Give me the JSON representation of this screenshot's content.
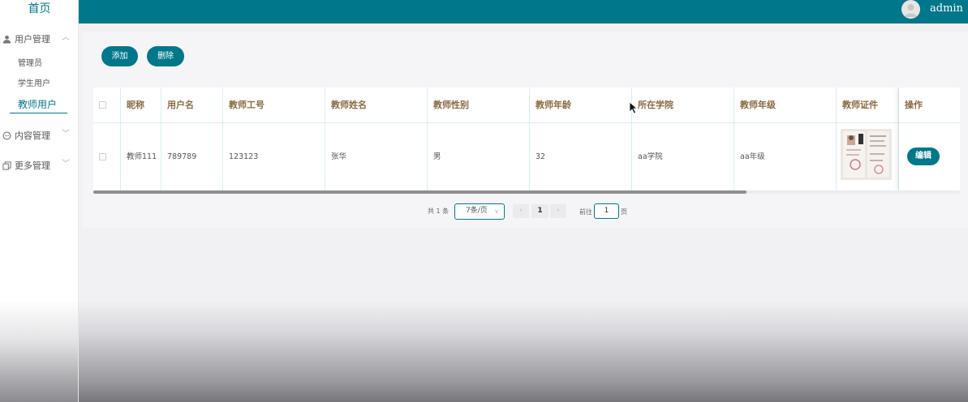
{
  "sidebar": {
    "home": "首页",
    "groups": [
      {
        "label": "用户管理",
        "icon": "user-icon",
        "expanded": true,
        "items": [
          {
            "label": "管理员"
          },
          {
            "label": "学生用户"
          },
          {
            "label": "教师用户",
            "active": true
          }
        ]
      },
      {
        "label": "内容管理",
        "icon": "chat-icon",
        "expanded": false
      },
      {
        "label": "更多管理",
        "icon": "copy-icon",
        "expanded": false
      }
    ]
  },
  "header": {
    "user": "admin",
    "bg_color": "#00778b"
  },
  "toolbar": {
    "add_label": "添加",
    "delete_label": "删除"
  },
  "table": {
    "columns": [
      "昵称",
      "用户名",
      "教师工号",
      "教师姓名",
      "教师性别",
      "教师年龄",
      "所在学院",
      "教师年级",
      "教师证件",
      "操作"
    ],
    "rows": [
      {
        "nickname": "教师111",
        "username": "789789",
        "teacher_no": "123123",
        "name": "张华",
        "gender": "男",
        "age": "32",
        "college": "aa学院",
        "grade": "aa年级",
        "edit_label": "编辑"
      }
    ]
  },
  "pagination": {
    "total": "共 1 条",
    "page_size": "7条/页",
    "current_page": "1",
    "goto_label": "前往",
    "goto_value": "1",
    "page_suffix": "页"
  },
  "colors": {
    "accent": "#00778b",
    "header_text": "#8a6a44"
  }
}
